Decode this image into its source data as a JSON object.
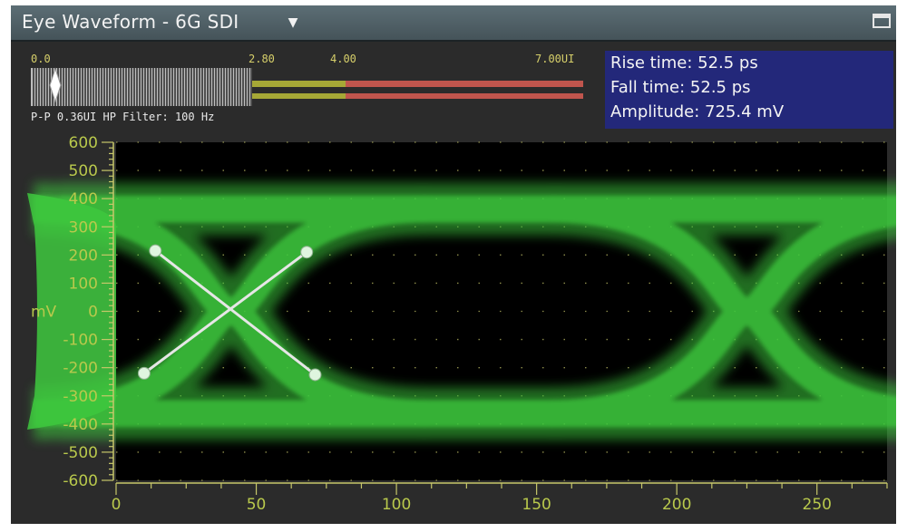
{
  "window": {
    "title": "Eye Waveform - 6G SDI",
    "dropdown_icon": "▼",
    "maximize_icon": "maximize-icon"
  },
  "jitter_meter": {
    "scale_labels": [
      "0.0",
      "2.80",
      "4.00",
      "7.00UI"
    ],
    "readout": "P-P 0.36UI HP Filter: 100 Hz",
    "pp_value_ui": 0.36,
    "colors": {
      "normal": "#d9d9d9",
      "caution": "#a6a836",
      "alarm": "#c0554d"
    }
  },
  "measurements": {
    "rise": "Rise time: 52.5 ps",
    "fall": "Fall time: 52.5 ps",
    "amplitude": "Amplitude: 725.4 mV"
  },
  "chart_data": {
    "type": "eye-diagram",
    "ylabel": "mV",
    "ylim": [
      -600,
      600
    ],
    "yticks": [
      600,
      500,
      400,
      300,
      200,
      100,
      0,
      -100,
      -200,
      -300,
      -400,
      -500,
      -600
    ],
    "ytick_labels": [
      "600",
      "500",
      "400",
      "300",
      "200",
      "100",
      "0",
      "-100",
      "-200",
      "-300",
      "-400",
      "-500",
      "-600"
    ],
    "xlim": [
      0,
      275
    ],
    "xticks": [
      0,
      50,
      100,
      150,
      200,
      250
    ],
    "xtick_labels": [
      "0",
      "50",
      "100",
      "150",
      "200",
      "250"
    ],
    "high_level_mv": 363,
    "low_level_mv": -363,
    "crossings_x": [
      41,
      225
    ],
    "rise_fall_markers": {
      "rise": [
        [
          10,
          -220
        ],
        [
          68,
          210
        ]
      ],
      "fall": [
        [
          14,
          215
        ],
        [
          71,
          -225
        ]
      ]
    },
    "colors": {
      "trace": "#3ec83e",
      "grid": "#c7c76a",
      "background": "#000000",
      "marker": "#e6e6e6"
    }
  }
}
